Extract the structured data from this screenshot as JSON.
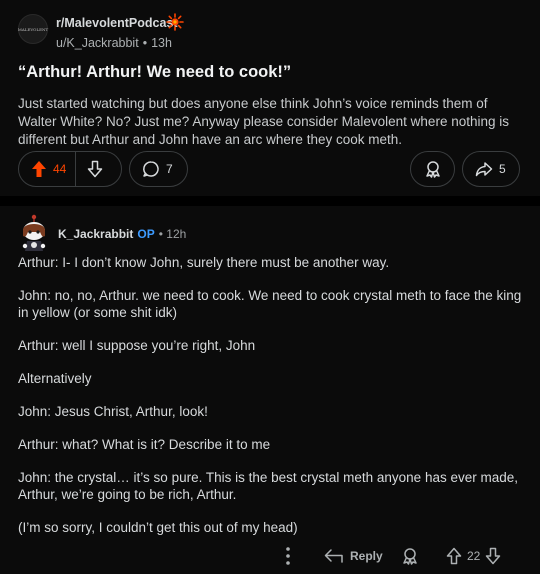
{
  "post": {
    "subreddit": "r/MalevolentPodcast",
    "subreddit_avatar_text": "MALEVOLENT",
    "author": "u/K_Jackrabbit",
    "age": "13h",
    "title": "“Arthur! Arthur! We need to cook!”",
    "body": "Just started watching but does anyone else think John’s voice reminds them of Walter White? No? Just me? Anyway please consider Malevolent where nothing is different but Arthur and John have an arc where they cook meth.",
    "upvotes": "44",
    "comments": "7",
    "shares": "5",
    "accent_color": "#ff4500"
  },
  "comment": {
    "author": "K_Jackrabbit",
    "op_badge": "OP",
    "age": "12h",
    "paragraphs": [
      "Arthur: I- I don’t know John, surely there must be another way.",
      "John: no, no, Arthur. we need to cook. We need to cook crystal meth to face the king in yellow (or some shit idk)",
      "Arthur: well I suppose you’re right, John",
      "Alternatively",
      "John: Jesus Christ, Arthur, look!",
      "Arthur: what? What is it? Describe it to me",
      "John: the crystal… it’s so pure. This is the best crystal meth anyone has ever made, Arthur, we’re going to be rich, Arthur.",
      "(I’m so sorry, I couldn’t get this out of my head)"
    ],
    "reply_label": "Reply",
    "score": "22",
    "op_color": "#3d9bff"
  },
  "icons": {
    "upvote": "arrow-up-icon",
    "downvote": "arrow-down-icon",
    "comment": "speech-bubble-icon",
    "award": "award-icon",
    "share": "share-arrow-icon",
    "more": "more-vertical-icon",
    "reply": "reply-arrow-icon"
  }
}
